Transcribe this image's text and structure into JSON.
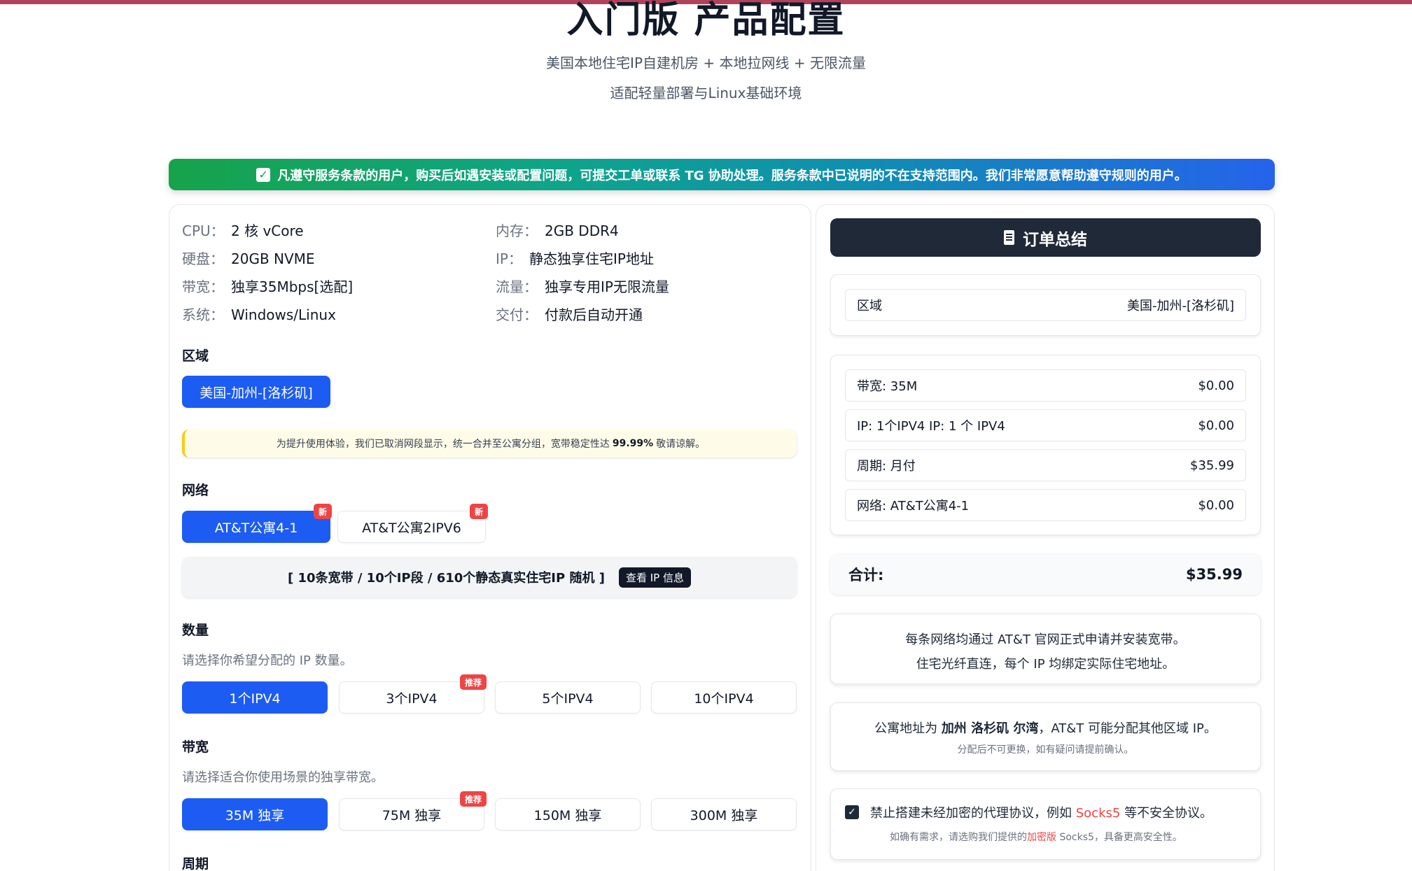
{
  "header": {
    "title": "入门版 产品配置",
    "subtitle1": "美国本地住宅IP自建机房 + 本地拉网线 + 无限流量",
    "subtitle2": "适配轻量部署与Linux基础环境"
  },
  "banner": {
    "check": "✓",
    "text": "凡遵守服务条款的用户，购买后如遇安装或配置问题，可提交工单或联系 TG 协助处理。服务条款中已说明的不在支持范围内。我们非常愿意帮助遵守规则的用户。"
  },
  "specs": [
    {
      "key": "CPU：",
      "value": "2 核 vCore"
    },
    {
      "key": "内存：",
      "value": "2GB DDR4"
    },
    {
      "key": "硬盘：",
      "value": "20GB NVME"
    },
    {
      "key": "IP：",
      "value": "静态独享住宅IP地址"
    },
    {
      "key": "带宽：",
      "value": "独享35Mbps[选配]"
    },
    {
      "key": "流量：",
      "value": "独享专用IP无限流量"
    },
    {
      "key": "系统：",
      "value": "Windows/Linux"
    },
    {
      "key": "交付：",
      "value": "付款后自动开通"
    }
  ],
  "region": {
    "title": "区域",
    "option": "美国-加州-[洛杉矶]",
    "notice_pre": "为提升使用体验，我们已取消网段显示，统一合并至公寓分组，宽带稳定性达",
    "notice_pct": "99.99%",
    "notice_post": "敬请谅解。"
  },
  "network": {
    "title": "网络",
    "options": [
      {
        "label": "AT&T公寓4-1",
        "badge": "新"
      },
      {
        "label": "AT&T公寓2IPV6",
        "badge": "新"
      }
    ],
    "ipinfo": "[ 10条宽带 / 10个IP段 / 610个静态真实住宅IP 随机 ]",
    "ipbtn": "查看 IP 信息"
  },
  "quantity": {
    "title": "数量",
    "hint": "请选择你希望分配的 IP 数量。",
    "options": [
      "1个IPV4",
      "3个IPV4",
      "5个IPV4",
      "10个IPV4"
    ],
    "badge": "推荐"
  },
  "bandwidth": {
    "title": "带宽",
    "hint": "请选择适合你使用场景的独享带宽。",
    "options": [
      "35M 独享",
      "75M 独享",
      "150M 独享",
      "300M 独享"
    ],
    "badge": "推荐"
  },
  "period": {
    "title": "周期"
  },
  "order": {
    "title": "订单总结",
    "region_label": "区域",
    "region_value": "美国-加州-[洛杉矶]",
    "items": [
      {
        "label": "带宽: 35M",
        "price": "$0.00"
      },
      {
        "label": "IP: 1个IPV4  IP: 1 个 IPV4",
        "price": "$0.00"
      },
      {
        "label": "周期: 月付",
        "price": "$35.99"
      },
      {
        "label": "网络: AT&T公寓4-1",
        "price": "$0.00"
      }
    ],
    "total_label": "合计:",
    "total_value": "$35.99",
    "info1_line1": "每条网络均通过 AT&T 官网正式申请并安装宽带。",
    "info1_line2": "住宅光纤直连，每个 IP 均绑定实际住宅地址。",
    "info2_pre": "公寓地址为",
    "info2_bold": "加州 洛杉矶 尔湾",
    "info2_post": "，AT&T 可能分配其他区域 IP。",
    "info2_small": "分配后不可更换，如有疑问请提前确认。",
    "agree_check": "✓",
    "agree_pre": "禁止搭建未经加密的代理协议，例如",
    "agree_red": "Socks5",
    "agree_post": "等不安全协议。",
    "agree_small_pre": "如确有需求，请选购我们提供的",
    "agree_small_red": "加密版",
    "agree_small_post": " Socks5，具备更高安全性。"
  }
}
